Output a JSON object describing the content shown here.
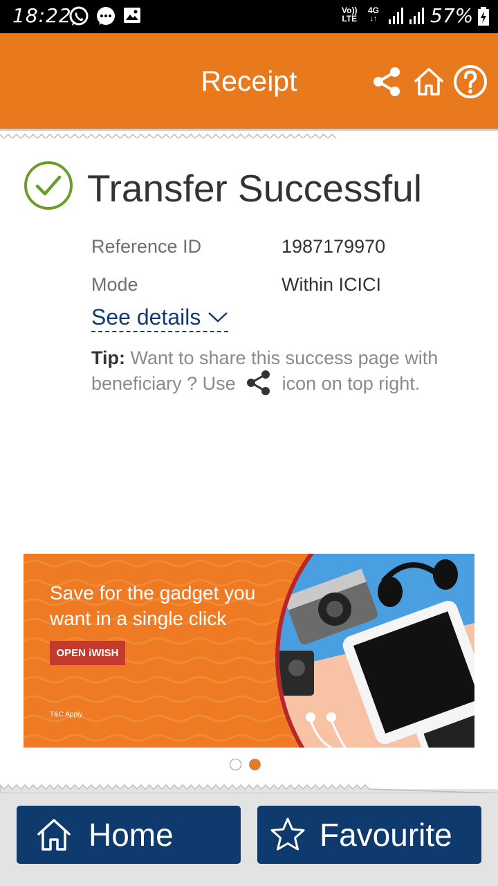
{
  "status_bar": {
    "time": "18:22",
    "network_volte": "Vo))",
    "network_lte": "LTE",
    "network_4g": "4G",
    "battery_percent": "57%",
    "icons": [
      "whatsapp-icon",
      "chat-icon",
      "gallery-icon",
      "signal-icon",
      "signal-icon",
      "battery-icon"
    ]
  },
  "header": {
    "title": "Receipt",
    "actions": [
      "share-icon",
      "home-icon",
      "help-icon"
    ],
    "color": "#e8791c"
  },
  "result": {
    "status_icon": "check-circle-icon",
    "title": "Transfer Successful",
    "rows": [
      {
        "label": "Reference ID",
        "value": "1987179970"
      },
      {
        "label": "Mode",
        "value": "Within ICICI"
      }
    ],
    "see_details": "See details"
  },
  "tip": {
    "label": "Tip:",
    "text_before": " Want to share this success page with beneficiary ? Use",
    "text_after": "icon on top right."
  },
  "banner": {
    "headline_line1": "Save for the gadget you",
    "headline_line2": "want in a single click",
    "cta": "OPEN iWISH",
    "tc": "T&C Apply"
  },
  "carousel": {
    "count": 2,
    "active_index": 1,
    "active_color": "#e8791c"
  },
  "bottom_bar": {
    "home_label": "Home",
    "favourite_label": "Favourite",
    "button_color": "#0f3a6e"
  }
}
